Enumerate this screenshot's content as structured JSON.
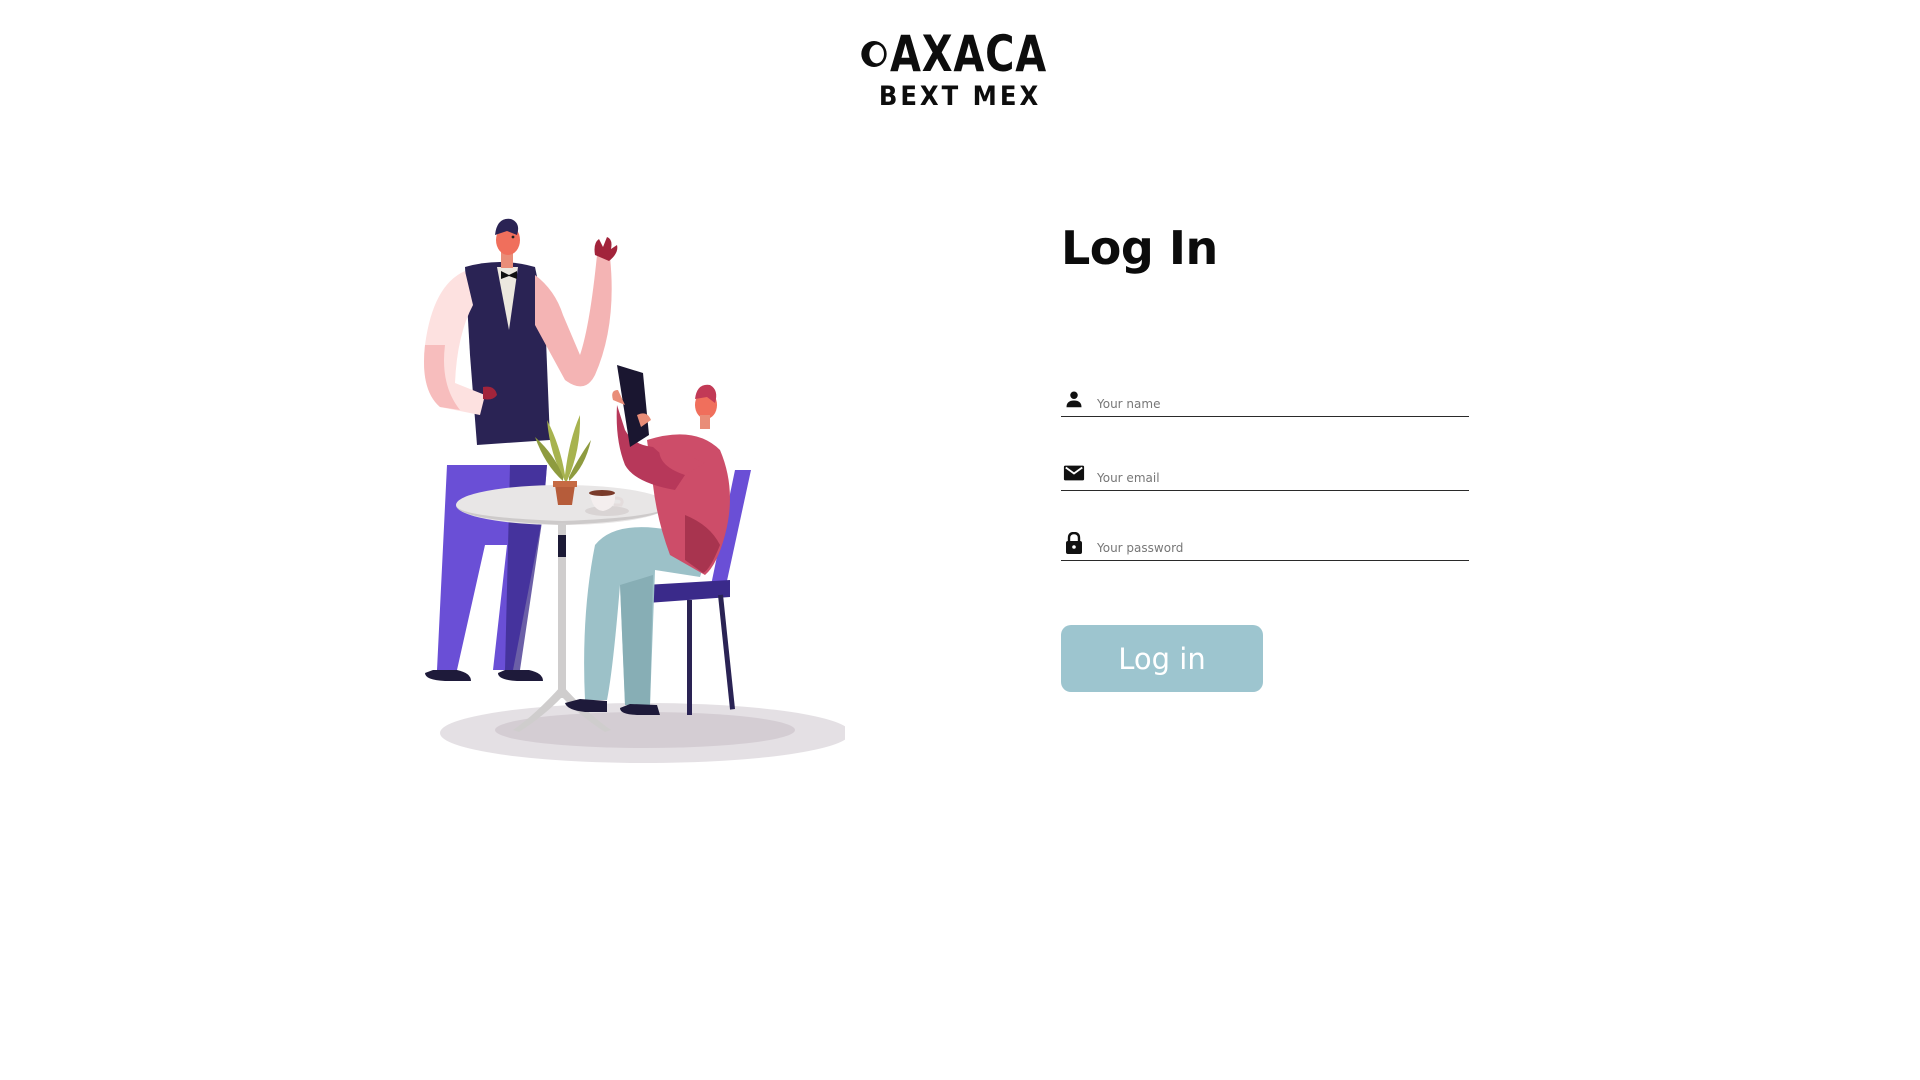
{
  "brand": {
    "name": "OAXACA",
    "name_rest": "AXACA",
    "tagline": "BEXT MEX"
  },
  "illustration": {
    "icon": "restaurant-waiter-illustration"
  },
  "login": {
    "title": "Log In",
    "fields": [
      {
        "icon": "person-icon",
        "placeholder": "Your name",
        "value": ""
      },
      {
        "icon": "mail-icon",
        "placeholder": "Your email",
        "value": ""
      },
      {
        "icon": "lock-icon",
        "placeholder": "Your password",
        "value": ""
      }
    ],
    "submit_label": "Log in"
  },
  "colors": {
    "accent_button": "#9dc5cf",
    "underline": "#2a2a2a",
    "text": "#0b0b0b"
  }
}
